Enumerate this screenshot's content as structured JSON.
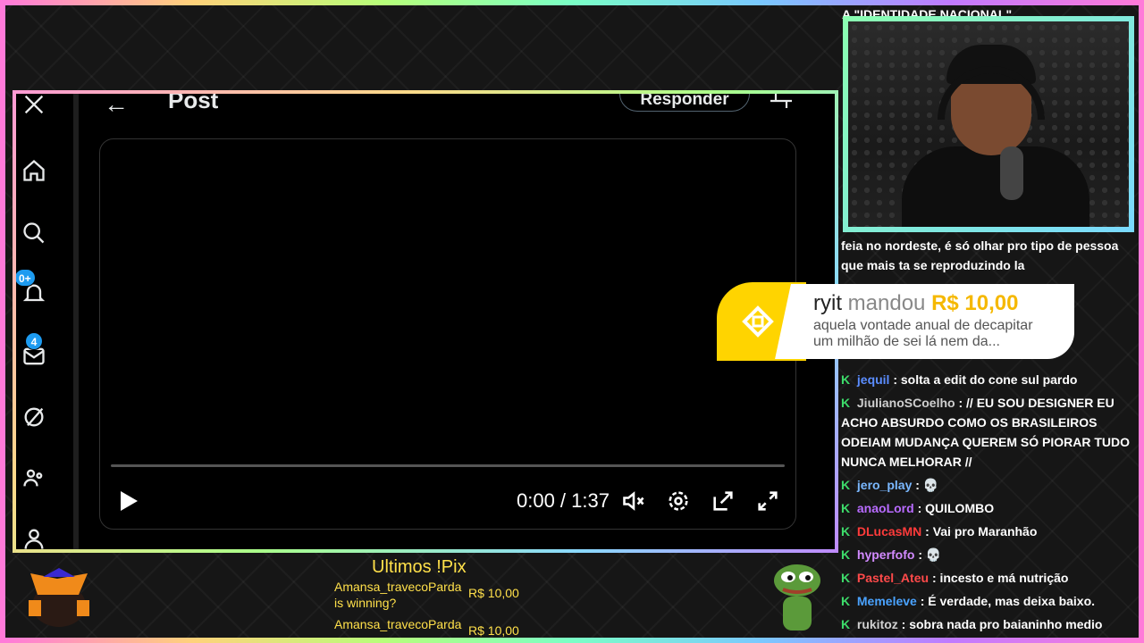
{
  "colors": {
    "accent": "#1d9bf0",
    "donation_yellow": "#ffd400",
    "pix_yellow": "#ffe04a",
    "chat_green": "#3ddc6a"
  },
  "post": {
    "back_icon": "arrow-left-icon",
    "title": "Post",
    "reply_label": "Responder",
    "badges": [
      "0+",
      "4"
    ],
    "video": {
      "time": "0:00 / 1:37",
      "progress": 0
    }
  },
  "webcam": {
    "overlay_title": "A \"IDENTIDADE NACIONAL\""
  },
  "donation": {
    "name": "ryit",
    "verb": "mandou",
    "amount": "R$ 10,00",
    "message": "aquela vontade anual de decapitar um milhão de sei lá nem da..."
  },
  "chat": {
    "top_message": "feia no nordeste, é só olhar pro tipo de pessoa que mais ta se reproduzindo la",
    "messages": [
      {
        "user": "jequil",
        "color": "#5b8dff",
        "text": ": solta a edit do cone sul pardo"
      },
      {
        "user": "JiulianoSCoelho",
        "color": "#cfcfcf",
        "text": ": // EU SOU DESIGNER EU ACHO ABSURDO COMO OS BRASILEIROS ODEIAM MUDANÇA QUEREM SÓ PIORAR TUDO NUNCA MELHORAR //"
      },
      {
        "user": "jero_play",
        "color": "#7ab8ff",
        "text": ":"
      },
      {
        "user": "anaoLord",
        "color": "#b86bff",
        "text": ": QUILOMBO"
      },
      {
        "user": "DLucasMN",
        "color": "#ff3b3b",
        "text": ": Vai pro Maranhão"
      },
      {
        "user": "hyperfofo",
        "color": "#d28aff",
        "text": ":"
      },
      {
        "user": "Pastel_Ateu",
        "color": "#ff4a4a",
        "text": ": incesto e má nutrição"
      },
      {
        "user": "Memeleve",
        "color": "#4aa3ff",
        "text": ": É verdade, mas deixa baixo."
      },
      {
        "user": "rukitoz",
        "color": "#cfcfcf",
        "text": ": sobra nada pro baianinho medio"
      }
    ]
  },
  "pix": {
    "title": "Ultimos !Pix",
    "items": [
      {
        "name": "Amansa_travecoParda",
        "message": "is winning?",
        "amount": "R$ 10,00"
      },
      {
        "name": "Amansa_travecoParda",
        "amount": "R$ 10,00"
      }
    ]
  }
}
